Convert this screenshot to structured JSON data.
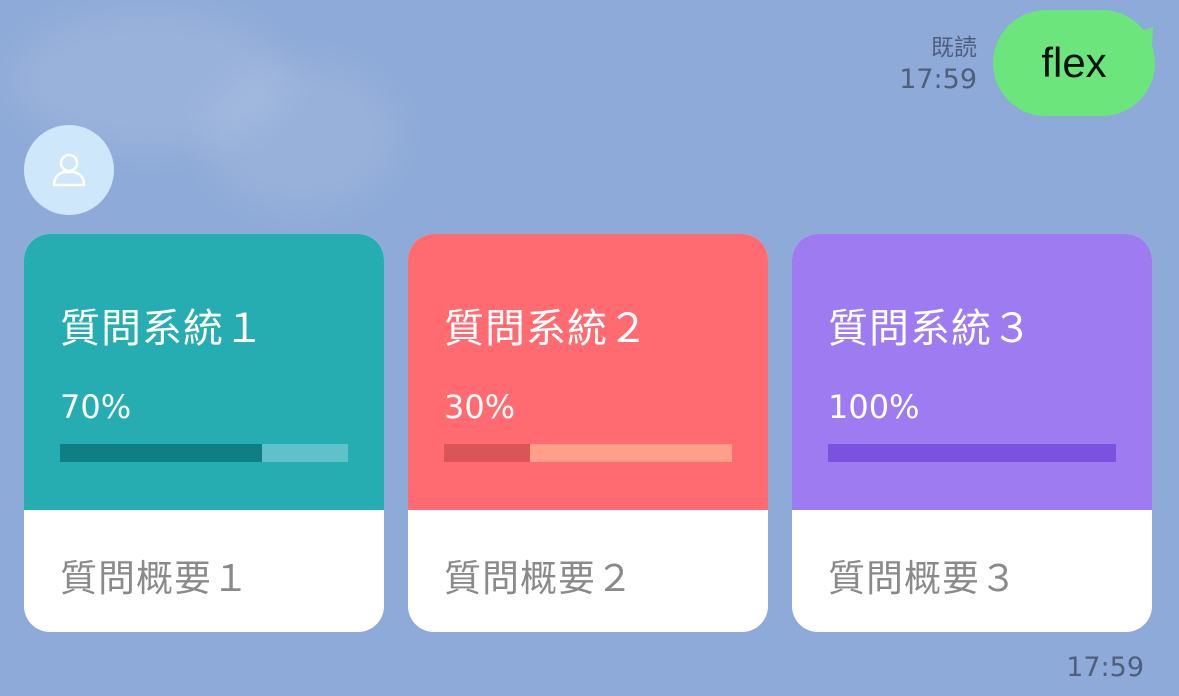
{
  "sent": {
    "text": "flex",
    "read_status": "既読",
    "time": "17:59",
    "bubble_color": "#6ce57c"
  },
  "avatar": {
    "icon": "user-icon"
  },
  "cards": [
    {
      "title": "質問系統１",
      "percent_label": "70%",
      "progress": 0.7,
      "summary": "質問概要１",
      "header_color": "#26adb1",
      "bar_color": "#0f7f84",
      "bar_track_color": "#5fc2cb"
    },
    {
      "title": "質問系統２",
      "percent_label": "30%",
      "progress": 0.3,
      "summary": "質問概要２",
      "header_color": "#ff6b70",
      "bar_color": "#d95557",
      "bar_track_color": "#ff9e8a"
    },
    {
      "title": "質問系統３",
      "percent_label": "100%",
      "progress": 1.0,
      "summary": "質問概要３",
      "header_color": "#9f7bf2",
      "bar_color": "#7b52e0",
      "bar_track_color": "#b89cf6"
    }
  ],
  "received": {
    "time": "17:59"
  }
}
